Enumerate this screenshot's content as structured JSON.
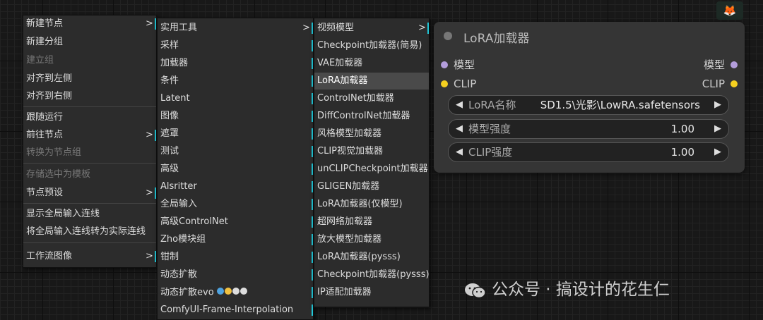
{
  "menu1": {
    "items": [
      {
        "label": "新建节点",
        "sub": true
      },
      {
        "label": "新建分组"
      },
      {
        "label": "建立组",
        "disabled": true
      },
      {
        "label": "对齐到左侧"
      },
      {
        "label": "对齐到右侧"
      },
      {
        "label": "跟随运行"
      },
      {
        "label": "前往节点",
        "sub": true
      },
      {
        "label": "转换为节点组",
        "disabled": true
      },
      {
        "label": "存储选中为模板",
        "disabled": true
      },
      {
        "label": "节点预设",
        "sub": true
      },
      {
        "label": "显示全局输入连线"
      },
      {
        "label": "将全局输入连线转为实际连线"
      },
      {
        "label": "工作流图像",
        "sub": true
      }
    ]
  },
  "menu2": {
    "items": [
      {
        "label": "实用工具",
        "sub": true
      },
      {
        "label": "采样",
        "sub": true
      },
      {
        "label": "加载器",
        "sub": true
      },
      {
        "label": "条件",
        "sub": true
      },
      {
        "label": "Latent",
        "sub": true
      },
      {
        "label": "图像",
        "sub": true
      },
      {
        "label": "遮罩",
        "sub": true
      },
      {
        "label": "测试",
        "sub": true
      },
      {
        "label": "高级",
        "sub": true
      },
      {
        "label": "Alsritter",
        "sub": true
      },
      {
        "label": "全局输入",
        "sub": true
      },
      {
        "label": "高级ControlNet",
        "sub": true
      },
      {
        "label": "Zho模块组",
        "sub": true
      },
      {
        "label": "钳制",
        "sub": true
      },
      {
        "label": "动态扩散",
        "sub": true
      },
      {
        "label": "动态扩散evo",
        "sub": true
      },
      {
        "label": "ComfyUI-Frame-Interpolation",
        "sub": true
      }
    ]
  },
  "menu3": {
    "items": [
      {
        "label": "视频模型",
        "sub": true
      },
      {
        "label": "Checkpoint加载器(简易)"
      },
      {
        "label": "VAE加载器"
      },
      {
        "label": "LoRA加载器",
        "active": true
      },
      {
        "label": "ControlNet加载器"
      },
      {
        "label": "DiffControlNet加载器"
      },
      {
        "label": "风格模型加载器"
      },
      {
        "label": "CLIP视觉加载器"
      },
      {
        "label": "unCLIPCheckpoint加载器"
      },
      {
        "label": "GLIGEN加载器"
      },
      {
        "label": "LoRA加载器(仅模型)"
      },
      {
        "label": "超网络加载器"
      },
      {
        "label": "放大模型加载器"
      },
      {
        "label": "LoRA加载器(pysss)"
      },
      {
        "label": "Checkpoint加载器(pysss)"
      },
      {
        "label": "IP适配加载器"
      }
    ]
  },
  "arrow_glyph": ">",
  "node": {
    "title": "LoRA加载器",
    "inputs": [
      {
        "label": "模型",
        "color": "#b39ddb"
      },
      {
        "label": "CLIP",
        "color": "#f5d020"
      }
    ],
    "outputs": [
      {
        "label": "模型",
        "color": "#b39ddb"
      },
      {
        "label": "CLIP",
        "color": "#f5d020"
      }
    ],
    "widgets": [
      {
        "label": "LoRA名称",
        "value": "SD1.5\\光影\\LowRA.safetensors"
      },
      {
        "label": "模型强度",
        "value": "1.00"
      },
      {
        "label": "CLIP强度",
        "value": "1.00"
      }
    ]
  },
  "fox_icon": "🦊",
  "watermark": "公众号 · 搞设计的花生仁",
  "colors": {
    "accent": "#22c8d8",
    "model_slot": "#b39ddb",
    "clip_slot": "#f5d020"
  }
}
